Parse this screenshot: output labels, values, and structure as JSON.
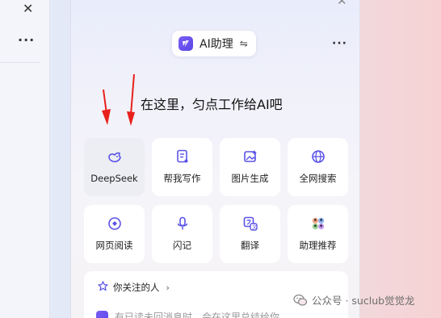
{
  "left_window": {
    "close_icon": "close-icon",
    "more_glyph": "···"
  },
  "panel": {
    "close_glyph": "✕",
    "assistant_title": "AI助理",
    "swap_glyph": "⇋",
    "more_glyph": "···",
    "headline": "在这里，匀点工作给AI吧"
  },
  "tiles": [
    {
      "label": "DeepSeek",
      "icon": "whale-icon",
      "active": true
    },
    {
      "label": "帮我写作",
      "icon": "document-pen-icon"
    },
    {
      "label": "图片生成",
      "icon": "image-sparkle-icon"
    },
    {
      "label": "全网搜索",
      "icon": "globe-icon"
    },
    {
      "label": "网页阅读",
      "icon": "compass-icon"
    },
    {
      "label": "闪记",
      "icon": "microphone-icon"
    },
    {
      "label": "翻译",
      "icon": "translate-icon"
    },
    {
      "label": "助理推荐",
      "icon": "avatars-icon"
    }
  ],
  "follow": {
    "title": "你关注的人",
    "chevron": "›",
    "message": "有已读未回消息时，会在这里总结给你"
  },
  "watermark": {
    "text": "公众号 · suclub觉觉龙"
  },
  "colors": {
    "accent": "#5b52e8",
    "arrow_red": "#e8201c"
  }
}
